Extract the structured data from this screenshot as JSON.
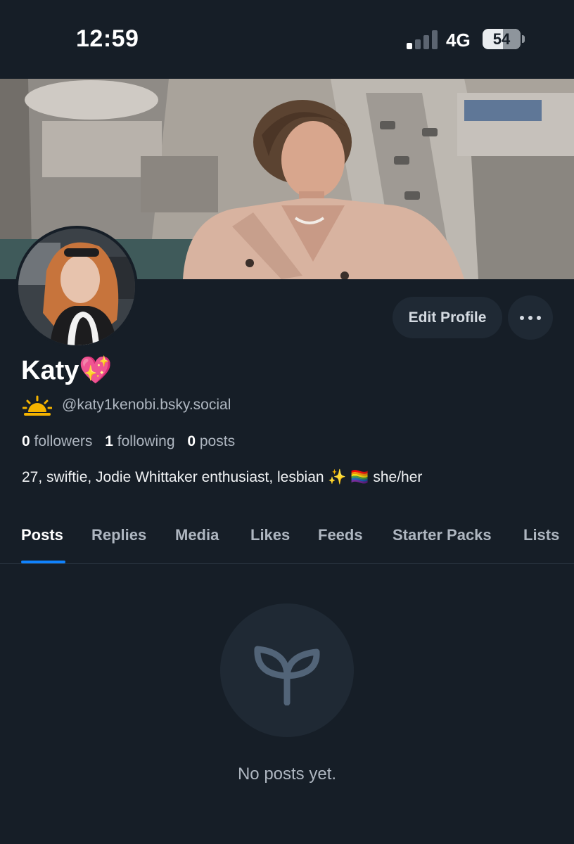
{
  "status_bar": {
    "time": "12:59",
    "network": "4G",
    "battery": "54",
    "battery_level": 0.54,
    "signal_bars_active": 1
  },
  "profile": {
    "display_name": "Katy💖",
    "handle_emoji": "sunrise-icon",
    "handle": "@katy1kenobi.bsky.social",
    "stats": {
      "followers_count": "0",
      "followers_label": "followers",
      "following_count": "1",
      "following_label": "following",
      "posts_count": "0",
      "posts_label": "posts"
    },
    "bio": "27, swiftie, Jodie Whittaker enthusiast, lesbian ✨ 🏳️‍🌈 she/her"
  },
  "actions": {
    "edit_profile_label": "Edit Profile",
    "more_icon": "ellipsis-icon"
  },
  "tabs": [
    {
      "label": "Posts",
      "active": true
    },
    {
      "label": "Replies",
      "active": false
    },
    {
      "label": "Media",
      "active": false
    },
    {
      "label": "Likes",
      "active": false
    },
    {
      "label": "Feeds",
      "active": false
    },
    {
      "label": "Starter Packs",
      "active": false
    },
    {
      "label": "Lists",
      "active": false
    }
  ],
  "empty_state": {
    "icon": "sprout-icon",
    "message": "No posts yet."
  },
  "colors": {
    "background": "#161e27",
    "accent": "#1083fe",
    "button_bg": "#1f2934",
    "muted_text": "#aeb6c0"
  }
}
